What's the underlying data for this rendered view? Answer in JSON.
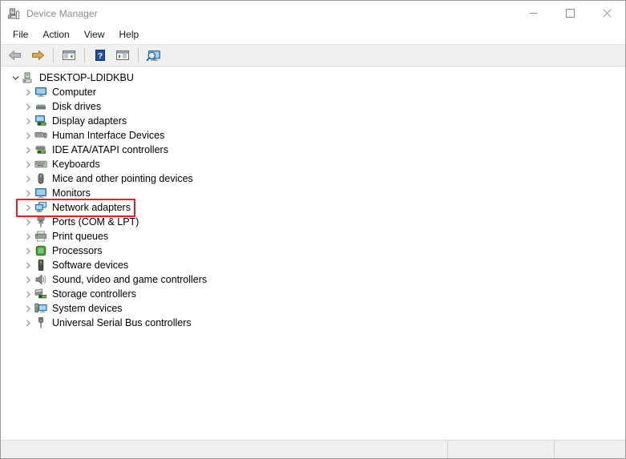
{
  "window": {
    "title": "Device Manager",
    "icon": "device-manager-icon",
    "caption_buttons": [
      {
        "name": "minimize",
        "glyph": "minimize-icon",
        "label": "Minimize"
      },
      {
        "name": "maximize",
        "glyph": "maximize-icon",
        "label": "Maximize"
      },
      {
        "name": "close",
        "glyph": "close-icon",
        "label": "Close"
      }
    ]
  },
  "menubar": {
    "items": [
      {
        "label": "File",
        "name": "menu-file"
      },
      {
        "label": "Action",
        "name": "menu-action"
      },
      {
        "label": "View",
        "name": "menu-view"
      },
      {
        "label": "Help",
        "name": "menu-help"
      }
    ]
  },
  "toolbar": {
    "buttons": [
      {
        "name": "back-button",
        "icon": "back-arrow-icon"
      },
      {
        "name": "forward-button",
        "icon": "forward-arrow-icon"
      },
      {
        "name": "separator-1",
        "icon": "separator"
      },
      {
        "name": "show-hide-console-tree-button",
        "icon": "console-tree-icon"
      },
      {
        "name": "separator-2",
        "icon": "separator"
      },
      {
        "name": "help-button",
        "icon": "help-question-icon"
      },
      {
        "name": "properties-button",
        "icon": "properties-icon"
      },
      {
        "name": "separator-3",
        "icon": "separator"
      },
      {
        "name": "scan-for-hardware-changes-button",
        "icon": "scan-hardware-icon"
      }
    ]
  },
  "tree": {
    "root": {
      "label": "DESKTOP-LDIDKBU",
      "icon": "computer-root-icon",
      "expanded": true
    },
    "items": [
      {
        "label": "Computer",
        "icon": "computer-icon",
        "name": "tree-item-computer"
      },
      {
        "label": "Disk drives",
        "icon": "disk-drive-icon",
        "name": "tree-item-disk-drives"
      },
      {
        "label": "Display adapters",
        "icon": "display-adapter-icon",
        "name": "tree-item-display-adapters"
      },
      {
        "label": "Human Interface Devices",
        "icon": "hid-icon",
        "name": "tree-item-human-interface-devices"
      },
      {
        "label": "IDE ATA/ATAPI controllers",
        "icon": "ide-controller-icon",
        "name": "tree-item-ide-ata-atapi-controllers"
      },
      {
        "label": "Keyboards",
        "icon": "keyboard-icon",
        "name": "tree-item-keyboards"
      },
      {
        "label": "Mice and other pointing devices",
        "icon": "mouse-icon",
        "name": "tree-item-mice-and-other-pointing-devices"
      },
      {
        "label": "Monitors",
        "icon": "monitor-icon",
        "name": "tree-item-monitors"
      },
      {
        "label": "Network adapters",
        "icon": "network-adapter-icon",
        "name": "tree-item-network-adapters",
        "highlighted": true
      },
      {
        "label": "Ports (COM & LPT)",
        "icon": "port-plug-icon",
        "name": "tree-item-ports-com-and-lpt"
      },
      {
        "label": "Print queues",
        "icon": "printer-icon",
        "name": "tree-item-print-queues"
      },
      {
        "label": "Processors",
        "icon": "processor-chip-icon",
        "name": "tree-item-processors"
      },
      {
        "label": "Software devices",
        "icon": "software-device-icon",
        "name": "tree-item-software-devices"
      },
      {
        "label": "Sound, video and game controllers",
        "icon": "speaker-icon",
        "name": "tree-item-sound-video-and-game-controllers"
      },
      {
        "label": "Storage controllers",
        "icon": "storage-controller-icon",
        "name": "tree-item-storage-controllers"
      },
      {
        "label": "System devices",
        "icon": "system-device-icon",
        "name": "tree-item-system-devices"
      },
      {
        "label": "Universal Serial Bus controllers",
        "icon": "usb-icon",
        "name": "tree-item-universal-serial-bus-controllers"
      }
    ]
  },
  "highlight": {
    "target": "Network adapters",
    "color": "#ed1c24"
  },
  "statusbar": {
    "pane_main": "",
    "pane_2": "",
    "pane_3": ""
  }
}
